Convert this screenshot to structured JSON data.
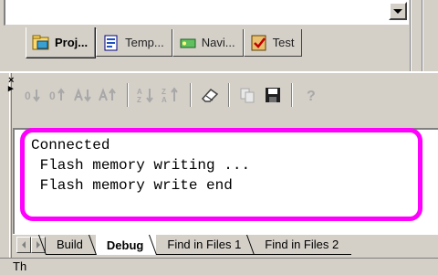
{
  "workspace": {
    "tabs": [
      {
        "label": "Proj...",
        "icon": "project-icon",
        "active": true
      },
      {
        "label": "Temp...",
        "icon": "template-icon",
        "active": false
      },
      {
        "label": "Navi...",
        "icon": "navigator-icon",
        "active": false
      },
      {
        "label": "Test",
        "icon": "test-icon",
        "active": false
      }
    ]
  },
  "toolbar": {
    "buttons": [
      "sort-icon",
      "sort-reverse-icon",
      "sort-ascending-icon",
      "sort-descending-icon",
      "sort-az-icon",
      "sort-za-icon",
      "eraser-icon",
      "copy-icon",
      "save-icon",
      "help-icon"
    ]
  },
  "output": {
    "lines": [
      "Connected",
      " Flash memory writing ...",
      " Flash memory write end"
    ],
    "highlight_color": "#ff00ff"
  },
  "output_tabs": [
    {
      "label": "Build",
      "active": false
    },
    {
      "label": "Debug",
      "active": true
    },
    {
      "label": "Find in Files 1",
      "active": false
    },
    {
      "label": "Find in Files 2",
      "active": false
    }
  ],
  "status": {
    "text": "Th"
  }
}
